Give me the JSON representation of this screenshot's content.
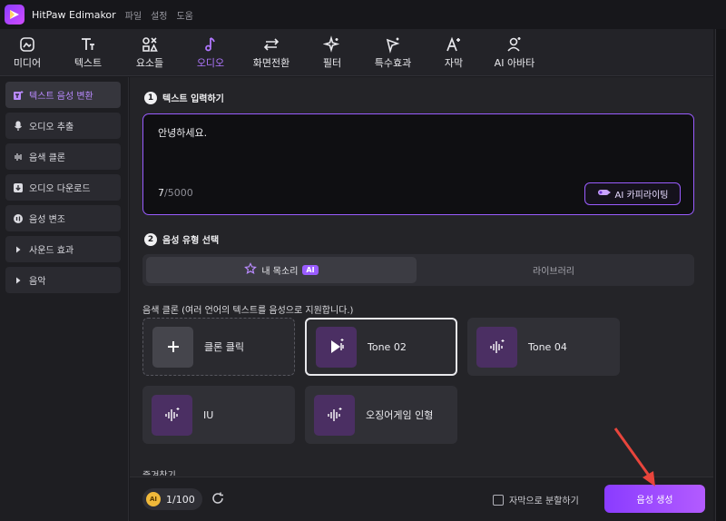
{
  "app": {
    "title": "HitPaw Edimakor",
    "menus": [
      "파일",
      "설정",
      "도움"
    ]
  },
  "toolbar": {
    "items": [
      {
        "label": "미디어",
        "icon": "media-icon"
      },
      {
        "label": "텍스트",
        "icon": "text-icon"
      },
      {
        "label": "요소들",
        "icon": "elements-icon"
      },
      {
        "label": "오디오",
        "icon": "audio-icon"
      },
      {
        "label": "화면전환",
        "icon": "transition-icon"
      },
      {
        "label": "필터",
        "icon": "filter-icon"
      },
      {
        "label": "특수효과",
        "icon": "effects-icon"
      },
      {
        "label": "자막",
        "icon": "subtitle-icon"
      },
      {
        "label": "AI 아바타",
        "icon": "avatar-icon"
      }
    ],
    "active": "오디오"
  },
  "sidebar": {
    "items": [
      {
        "label": "텍스트 음성 변환",
        "icon": "tts-icon",
        "active": true
      },
      {
        "label": "오디오 추출",
        "icon": "microphone-icon"
      },
      {
        "label": "음색 클론",
        "icon": "waveform-icon"
      },
      {
        "label": "오디오 다운로드",
        "icon": "download-icon"
      },
      {
        "label": "음성 변조",
        "icon": "voice-changer-icon"
      },
      {
        "label": "사운드 효과",
        "icon": "triangle-right-icon"
      },
      {
        "label": "음악",
        "icon": "triangle-right-icon"
      }
    ]
  },
  "main": {
    "step1": {
      "number": "1",
      "title": "텍스트 입력하기"
    },
    "text_input": {
      "value": "안녕하세요.",
      "count": "7",
      "max": "/5000",
      "ai_button": "AI 카피라이팅"
    },
    "step2": {
      "number": "2",
      "title": "음성 유형 선택"
    },
    "tabs": {
      "my_voice": "내 목소리",
      "ai_badge": "AI",
      "library": "라이브러리"
    },
    "clone_caption": "음색 클론 (여러 언어의 텍스트를 음성으로 지원합니다.)",
    "voice_cards": [
      {
        "label": "클론 클릭",
        "icon": "plus-icon"
      },
      {
        "label": "Tone 02",
        "icon": "voice-wave-icon",
        "selected": true
      },
      {
        "label": "Tone 04",
        "icon": "voice-wave-icon"
      },
      {
        "label": "IU",
        "icon": "voice-wave-icon"
      },
      {
        "label": "오징어게임 인형",
        "icon": "voice-wave-icon"
      }
    ],
    "favorites_label": "즐겨찾기"
  },
  "footer": {
    "coin_label": "AI",
    "credits": "1/100",
    "split_label": "자막으로 분할하기",
    "generate_label": "음성 생성"
  },
  "colors": {
    "accent": "#9a5cff",
    "generate_start": "#8a3cff",
    "generate_end": "#b35bff",
    "annotation_arrow": "#e8453c"
  }
}
